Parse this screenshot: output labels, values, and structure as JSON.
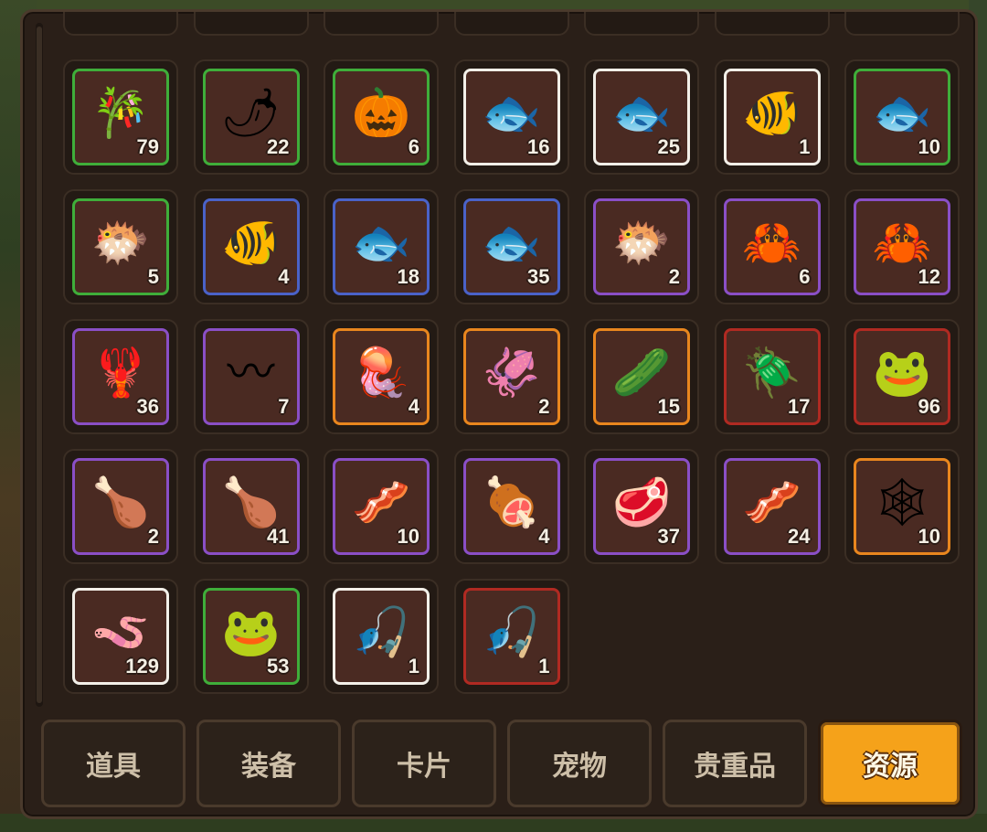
{
  "inventory": {
    "items": [
      {
        "icon": "sugarcane-icon",
        "glyph": "🎋",
        "count": "79",
        "rarity": "green"
      },
      {
        "icon": "chili-pepper-icon",
        "glyph": "🌶",
        "count": "22",
        "rarity": "green"
      },
      {
        "icon": "pumpkin-icon",
        "glyph": "🎃",
        "count": "6",
        "rarity": "green"
      },
      {
        "icon": "white-fish-icon",
        "glyph": "🐟",
        "count": "16",
        "rarity": "white"
      },
      {
        "icon": "catfish-icon",
        "glyph": "🐟",
        "count": "25",
        "rarity": "white"
      },
      {
        "icon": "yellow-fish-icon",
        "glyph": "🐠",
        "count": "1",
        "rarity": "white"
      },
      {
        "icon": "pomfret-icon",
        "glyph": "🐟",
        "count": "10",
        "rarity": "green"
      },
      {
        "icon": "piranha-icon",
        "glyph": "🐡",
        "count": "5",
        "rarity": "green"
      },
      {
        "icon": "red-snapper-icon",
        "glyph": "🐠",
        "count": "4",
        "rarity": "blue"
      },
      {
        "icon": "swordfish-icon",
        "glyph": "🐟",
        "count": "18",
        "rarity": "blue"
      },
      {
        "icon": "tuna-icon",
        "glyph": "🐟",
        "count": "35",
        "rarity": "blue"
      },
      {
        "icon": "anglerfish-icon",
        "glyph": "🐡",
        "count": "2",
        "rarity": "purple"
      },
      {
        "icon": "green-crab-icon",
        "glyph": "🦀",
        "count": "6",
        "rarity": "purple"
      },
      {
        "icon": "king-crab-icon",
        "glyph": "🦀",
        "count": "12",
        "rarity": "purple"
      },
      {
        "icon": "lobster-icon",
        "glyph": "🦞",
        "count": "36",
        "rarity": "purple"
      },
      {
        "icon": "eel-icon",
        "glyph": "〰",
        "count": "7",
        "rarity": "purple"
      },
      {
        "icon": "jellyfish-icon",
        "glyph": "🪼",
        "count": "4",
        "rarity": "orange"
      },
      {
        "icon": "squid-icon",
        "glyph": "🦑",
        "count": "2",
        "rarity": "orange"
      },
      {
        "icon": "sea-cucumber-icon",
        "glyph": "🥒",
        "count": "15",
        "rarity": "orange"
      },
      {
        "icon": "beetle-icon",
        "glyph": "🪲",
        "count": "17",
        "rarity": "red"
      },
      {
        "icon": "frog-creature-icon",
        "glyph": "🐸",
        "count": "96",
        "rarity": "red"
      },
      {
        "icon": "drumstick-icon",
        "glyph": "🍗",
        "count": "2",
        "rarity": "purple"
      },
      {
        "icon": "roast-chicken-icon",
        "glyph": "🍗",
        "count": "41",
        "rarity": "purple"
      },
      {
        "icon": "bacon-icon",
        "glyph": "🥓",
        "count": "10",
        "rarity": "purple"
      },
      {
        "icon": "ham-icon",
        "glyph": "🍖",
        "count": "4",
        "rarity": "purple"
      },
      {
        "icon": "steak-icon",
        "glyph": "🥩",
        "count": "37",
        "rarity": "purple"
      },
      {
        "icon": "meat-strips-icon",
        "glyph": "🥓",
        "count": "24",
        "rarity": "purple"
      },
      {
        "icon": "fishing-net-icon",
        "glyph": "🕸",
        "count": "10",
        "rarity": "orange"
      },
      {
        "icon": "worm-bait-icon",
        "glyph": "🪱",
        "count": "129",
        "rarity": "white"
      },
      {
        "icon": "frog-bait-icon",
        "glyph": "🐸",
        "count": "53",
        "rarity": "green"
      },
      {
        "icon": "wooden-fishing-rod-icon",
        "glyph": "🎣",
        "count": "1",
        "rarity": "white"
      },
      {
        "icon": "reel-fishing-rod-icon",
        "glyph": "🎣",
        "count": "1",
        "rarity": "red"
      }
    ]
  },
  "rarity_colors": {
    "white": "#f2efe8",
    "green": "#3fae3a",
    "blue": "#4a62c8",
    "purple": "#8a4fc6",
    "orange": "#e9861e",
    "red": "#b02a22"
  },
  "tabs": [
    {
      "label": "道具",
      "active": false
    },
    {
      "label": "装备",
      "active": false
    },
    {
      "label": "卡片",
      "active": false
    },
    {
      "label": "宠物",
      "active": false
    },
    {
      "label": "贵重品",
      "active": false
    },
    {
      "label": "资源",
      "active": true
    }
  ],
  "accent_color": "#f5a21a"
}
